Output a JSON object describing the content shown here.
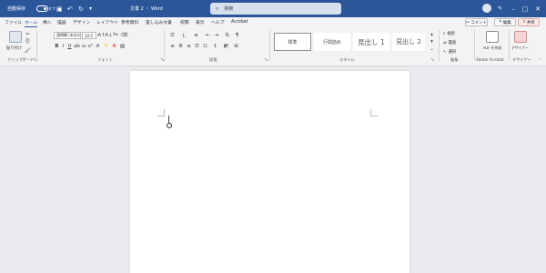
{
  "title_bar": {
    "autosave_label": "自動保存",
    "autosave_state": "オフ",
    "document_title": "文書 2 ・ Word",
    "search_placeholder": "検索",
    "icons": [
      "save-icon",
      "undo-icon",
      "redo-icon",
      "customize-icon",
      "pen-icon",
      "minimize-icon",
      "maximize-icon",
      "close-icon"
    ]
  },
  "tabs": [
    "ファイル",
    "ホーム",
    "挿入",
    "描画",
    "デザイン",
    "レイアウト",
    "参考資料",
    "差し込み文書",
    "校閲",
    "表示",
    "ヘルプ",
    "Acrobat"
  ],
  "active_tab": "ホーム",
  "top_right": {
    "comments_label": "コメント",
    "editing_label": "編集",
    "share_label": "共有"
  },
  "ribbon": {
    "clipboard": {
      "paste_label": "貼り付け",
      "group_label": "クリップボード"
    },
    "font": {
      "font_name": "游明朝 (本文のフォン",
      "font_size": "10.5",
      "case_label": "Aa",
      "group_label": "フォント"
    },
    "paragraph": {
      "group_label": "段落"
    },
    "styles": {
      "items": [
        "標準",
        "行間詰め",
        "見出し 1",
        "見出し 2"
      ],
      "group_label": "スタイル"
    },
    "editing": {
      "items": [
        "検索",
        "置換",
        "選択"
      ],
      "group_label": "編集"
    },
    "acrobat": {
      "create_pdf_label": "PDF を作成",
      "group_label": "Adobe Acrobat"
    },
    "designer": {
      "label": "デザイナー",
      "group_label": "デザイナー"
    }
  },
  "colors": {
    "title_bar": "#2b579a",
    "ribbon": "#f3f3f3",
    "canvas": "#e9ebee",
    "page": "#ffffff"
  }
}
